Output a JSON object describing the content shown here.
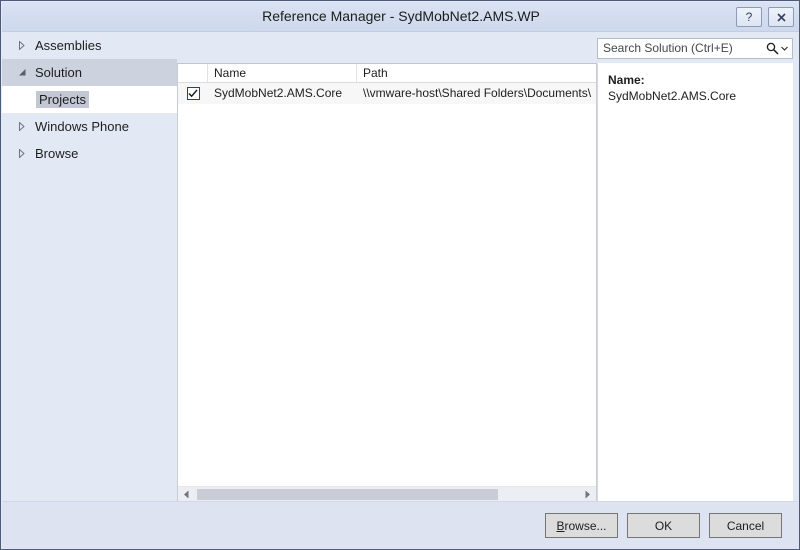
{
  "window": {
    "title": "Reference Manager - SydMobNet2.AMS.WP",
    "help_button_glyph": "?",
    "close_button_glyph": "✕"
  },
  "sidebar": {
    "items": [
      {
        "label": "Assemblies",
        "state": "collapsed"
      },
      {
        "label": "Solution",
        "state": "expanded"
      },
      {
        "label": "Projects",
        "state": "child-selected"
      },
      {
        "label": "Windows Phone",
        "state": "collapsed"
      },
      {
        "label": "Browse",
        "state": "collapsed"
      }
    ]
  },
  "search": {
    "placeholder": "Search Solution (Ctrl+E)",
    "value": ""
  },
  "list": {
    "columns": [
      "",
      "Name",
      "Path"
    ],
    "rows": [
      {
        "checked": true,
        "name": "SydMobNet2.AMS.Core",
        "path": "\\\\vmware-host\\Shared Folders\\Documents\\"
      }
    ]
  },
  "details": {
    "name_label": "Name:",
    "name_value": "SydMobNet2.AMS.Core"
  },
  "footer": {
    "browse_label_accel": "B",
    "browse_label_rest": "rowse...",
    "ok_label": "OK",
    "cancel_label": "Cancel"
  },
  "colors": {
    "window_border": "#4a5a78",
    "titlebar": "#d3ddef",
    "sidebar_bg": "#e3e9f4",
    "selected_row": "#ccd2de",
    "child_highlight": "#c3c7d4",
    "footer_bg": "#dde3f0",
    "list_row_bg": "#f7f7f7",
    "scroll_thumb": "#cbcdd6"
  }
}
